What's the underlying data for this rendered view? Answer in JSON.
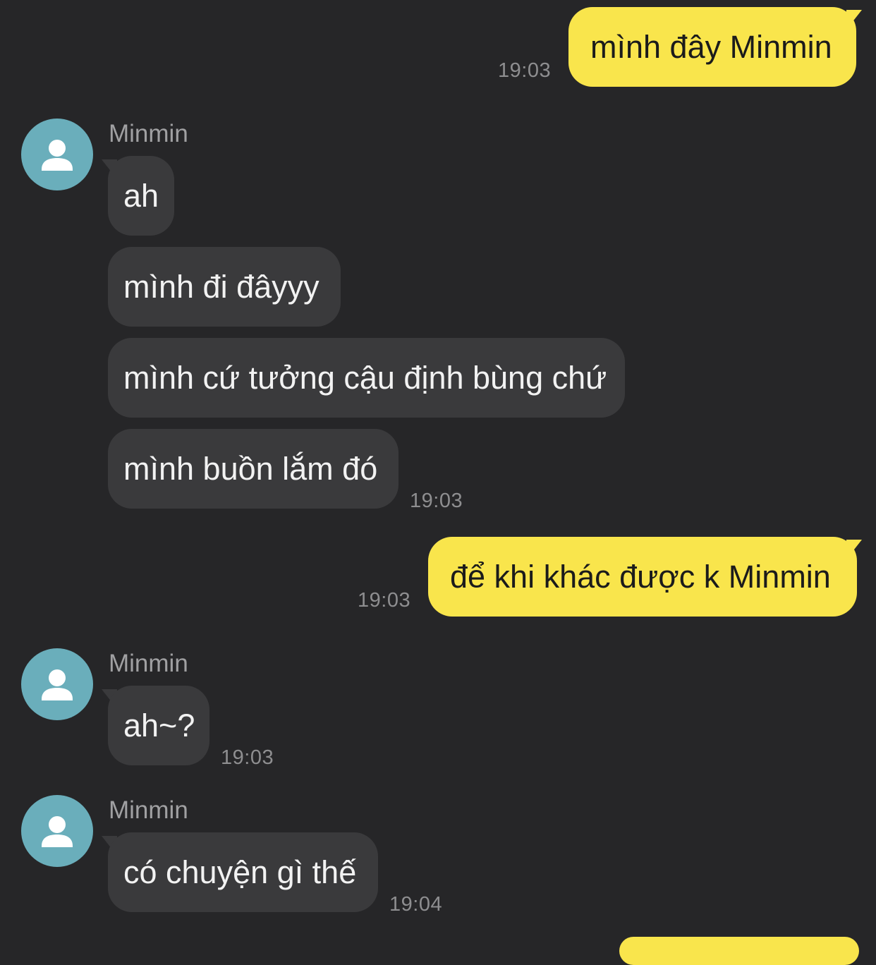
{
  "colors": {
    "background": "#262628",
    "incoming_bubble": "#3a3a3c",
    "outgoing_bubble": "#f9e54c",
    "avatar": "#6aaebb",
    "timestamp": "#8e8e90"
  },
  "messages": [
    {
      "direction": "out",
      "text": "mình đây Minmin",
      "time": "19:03"
    },
    {
      "direction": "in",
      "sender": "Minmin",
      "avatar_icon": "person-icon",
      "bubbles": [
        "ah",
        "mình đi đâyyy",
        "mình cứ tưởng cậu định bùng chứ",
        "mình buồn lắm đó"
      ],
      "time": "19:03"
    },
    {
      "direction": "out",
      "text": "để khi khác được k Minmin",
      "time": "19:03"
    },
    {
      "direction": "in",
      "sender": "Minmin",
      "avatar_icon": "person-icon",
      "bubbles": [
        "ah~?"
      ],
      "time": "19:03"
    },
    {
      "direction": "in",
      "sender": "Minmin",
      "avatar_icon": "person-icon",
      "bubbles": [
        "có chuyện gì thế"
      ],
      "time": "19:04"
    }
  ]
}
